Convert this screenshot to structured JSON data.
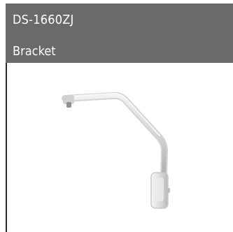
{
  "product": {
    "model": "DS-1660ZJ",
    "category": "Bracket",
    "image_icon": "wall-mount-bracket-icon"
  },
  "colors": {
    "header_background": "#6a6a6b",
    "header_text": "#ffffff",
    "border": "#2b2b2b",
    "page_background": "#ffffff"
  }
}
